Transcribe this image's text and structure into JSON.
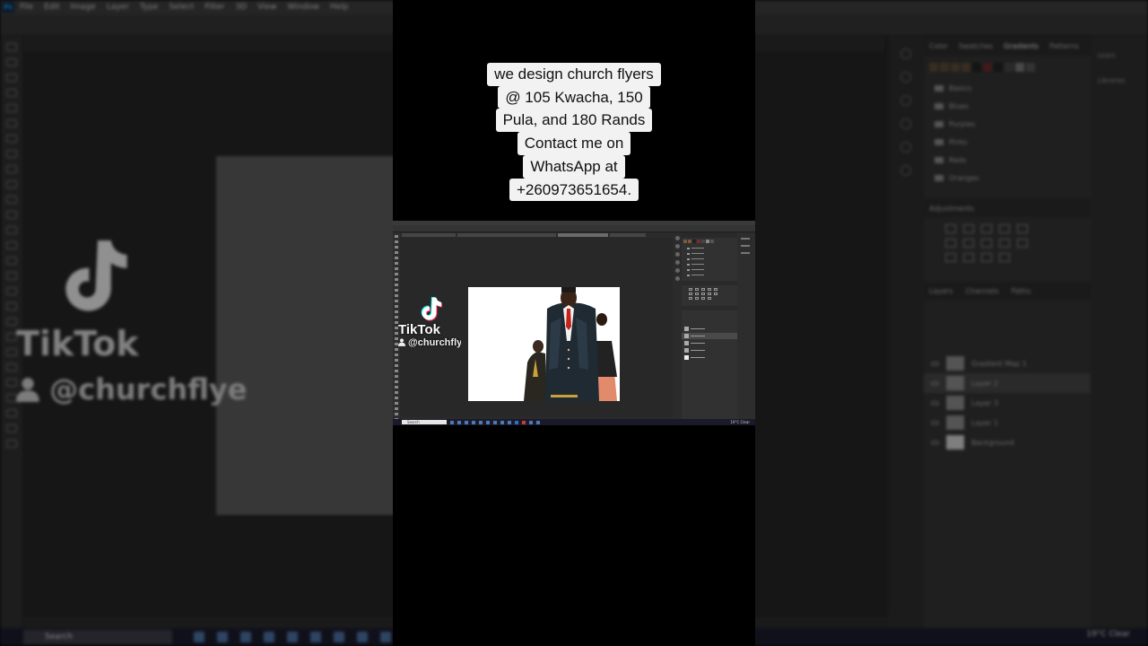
{
  "caption": {
    "lines": [
      "we design church flyers",
      "@ 105 Kwacha, 150",
      "Pula, and 180 Rands",
      "Contact me on",
      "WhatsApp at",
      "+260973651654."
    ]
  },
  "tiktok": {
    "brand": "TikTok",
    "username": "@churchflye",
    "background_username": "@churchflye",
    "icon": "tiktok-note-icon",
    "user_icon": "person-icon"
  },
  "background_app": {
    "menu": [
      "File",
      "Edit",
      "Image",
      "Layer",
      "Type",
      "Select",
      "Filter",
      "3D",
      "View",
      "Window",
      "Help"
    ],
    "panel_tabs": [
      "Color",
      "Swatches",
      "Gradients",
      "Patterns"
    ],
    "active_panel_tab": "Gradients",
    "gradient_folders": [
      "Basics",
      "Blues",
      "Purples",
      "Pinks",
      "Reds",
      "Oranges"
    ],
    "adjustments_title": "Adjustments",
    "layers_tabs": [
      "Layers",
      "Channels",
      "Paths"
    ],
    "layers": [
      "Gradient Map 1",
      "Layer 2",
      "Layer 3",
      "Layer 1",
      "Background"
    ],
    "selected_layer": "Layer 2",
    "far_right": [
      "Learn",
      "Libraries"
    ],
    "taskbar_search": "Search",
    "tray": "19°C Clear"
  },
  "colors": {
    "caption_bg": "#f2f2f2",
    "caption_text": "#111111",
    "app_bg": "#262626",
    "accent": "#31a8ff"
  }
}
